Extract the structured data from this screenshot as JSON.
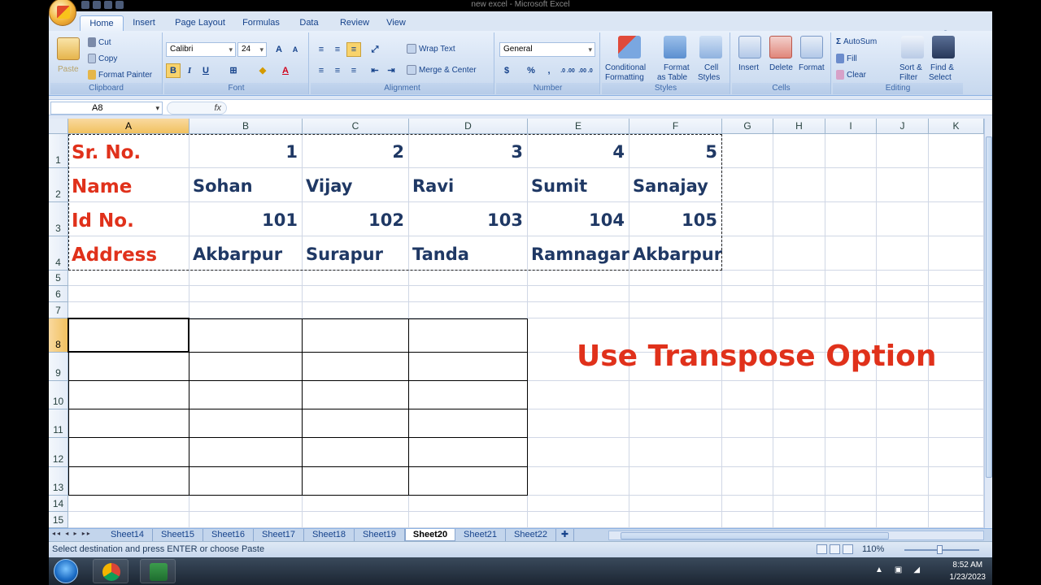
{
  "window": {
    "title": "new excel  -  Microsoft Excel"
  },
  "tabs": [
    "Home",
    "Insert",
    "Page Layout",
    "Formulas",
    "Data",
    "Review",
    "View"
  ],
  "active_tab": "Home",
  "clipboard": {
    "paste": "Paste",
    "cut": "Cut",
    "copy": "Copy",
    "format_painter": "Format Painter",
    "label": "Clipboard"
  },
  "font": {
    "name": "Calibri",
    "size": "24",
    "label": "Font",
    "bold": "B",
    "italic": "I",
    "underline": "U"
  },
  "alignment": {
    "wrap_text": "Wrap Text",
    "merge_center": "Merge & Center",
    "label": "Alignment"
  },
  "number": {
    "format": "General",
    "currency": "$",
    "percent": "%",
    "comma": ",",
    "inc_dec": ".0 .00",
    "dec_dec": ".00 .0",
    "label": "Number"
  },
  "styles": {
    "conditional": "Conditional",
    "conditional2": "Formatting",
    "format_table": "Format",
    "format_table2": "as Table",
    "cell_styles": "Cell",
    "cell_styles2": "Styles",
    "label": "Styles"
  },
  "cells": {
    "insert": "Insert",
    "delete": "Delete",
    "format": "Format",
    "label": "Cells"
  },
  "editing": {
    "autosum": "AutoSum",
    "fill": "Fill",
    "clear": "Clear",
    "sort": "Sort &",
    "sort2": "Filter",
    "find": "Find &",
    "find2": "Select",
    "label": "Editing"
  },
  "formula_bar": {
    "name_box": "A8",
    "fx": "fx",
    "formula": ""
  },
  "columns": [
    "A",
    "B",
    "C",
    "D",
    "E",
    "F",
    "G",
    "H",
    "I",
    "J",
    "K"
  ],
  "rows": [
    "1",
    "2",
    "3",
    "4",
    "5",
    "6",
    "7",
    "8",
    "9",
    "10",
    "11",
    "12",
    "13",
    "14",
    "15"
  ],
  "table": {
    "r1": {
      "label": "Sr. No.",
      "values": [
        "1",
        "2",
        "3",
        "4",
        "5"
      ]
    },
    "r2": {
      "label": "Name",
      "values": [
        "Sohan",
        "Vijay",
        "Ravi",
        "Sumit",
        "Sanajay"
      ]
    },
    "r3": {
      "label": "Id No.",
      "values": [
        "101",
        "102",
        "103",
        "104",
        "105"
      ]
    },
    "r4": {
      "label": "Address",
      "values": [
        "Akbarpur",
        "Surapur",
        "Tanda",
        "Ramnagar",
        "Akbarpur"
      ]
    }
  },
  "overlay_text": "Use Transpose Option",
  "sheets": [
    "Sheet14",
    "Sheet15",
    "Sheet16",
    "Sheet17",
    "Sheet18",
    "Sheet19",
    "Sheet20",
    "Sheet21",
    "Sheet22"
  ],
  "active_sheet": "Sheet20",
  "status": {
    "message": "Select destination and press ENTER or choose Paste",
    "zoom": "110%"
  },
  "taskbar": {
    "time": "8:52 AM",
    "date": "1/23/2023"
  },
  "colors": {
    "label_red": "#e0311b",
    "value_navy": "#1f3864",
    "ribbon_blue": "#dfe8f6"
  }
}
